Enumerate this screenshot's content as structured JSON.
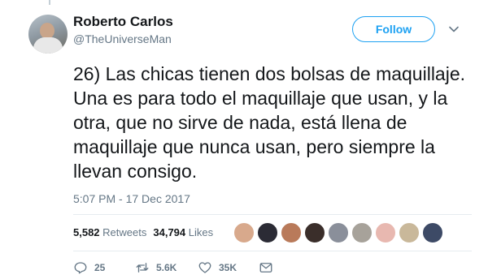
{
  "user": {
    "name": "Roberto Carlos",
    "handle": "@TheUniverseMan",
    "follow_label": "Follow"
  },
  "tweet": {
    "text": "26) Las chicas tienen dos bolsas de maquillaje. Una es para todo el maquillaje que usan, y la otra, que no sirve de nada, está llena de maquillaje que nunca usan, pero siempre la llevan consigo.",
    "timestamp": "5:07 PM - 17 Dec 2017"
  },
  "stats": {
    "retweets_count": "5,582",
    "retweets_label": "Retweets",
    "likes_count": "34,794",
    "likes_label": "Likes"
  },
  "actions": {
    "reply_count": "25",
    "retweet_count": "5.6K",
    "like_count": "35K"
  },
  "colors": {
    "accent": "#1da1f2",
    "secondary_text": "#657786",
    "primary_text": "#14171a"
  },
  "liker_avatars": [
    "#d8a98c",
    "#2b2b35",
    "#b97a5a",
    "#3a2e2a",
    "#8a8f9a",
    "#a7a29a",
    "#e8b8b0",
    "#c9b89a",
    "#3d4a66"
  ]
}
